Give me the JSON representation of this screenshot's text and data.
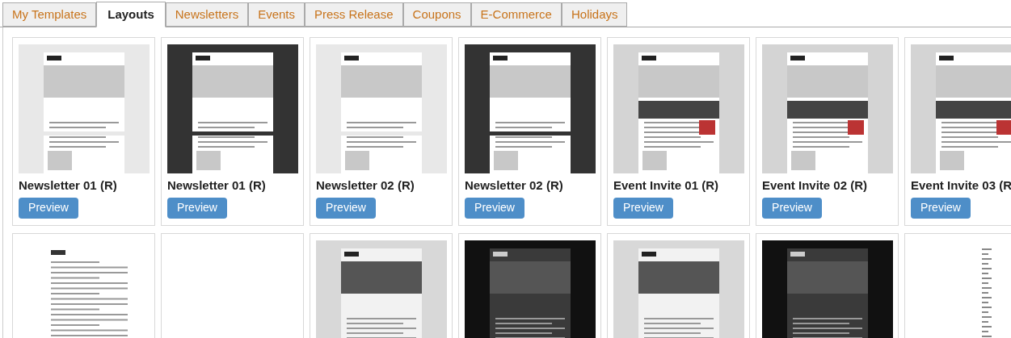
{
  "tabs": [
    {
      "label": "My Templates",
      "selected": false
    },
    {
      "label": "Layouts",
      "selected": true
    },
    {
      "label": "Newsletters",
      "selected": false
    },
    {
      "label": "Events",
      "selected": false
    },
    {
      "label": "Press Release",
      "selected": false
    },
    {
      "label": "Coupons",
      "selected": false
    },
    {
      "label": "E-Commerce",
      "selected": false
    },
    {
      "label": "Holidays",
      "selected": false
    }
  ],
  "template_rows": [
    [
      {
        "kind": "newsletter-light",
        "title": "Newsletter 01 (R)",
        "button": "Preview"
      },
      {
        "kind": "newsletter-dark",
        "title": "Newsletter 01 (R)",
        "button": "Preview"
      },
      {
        "kind": "newsletter-light",
        "title": "Newsletter 02 (R)",
        "button": "Preview"
      },
      {
        "kind": "newsletter-dark",
        "title": "Newsletter 02 (R)",
        "button": "Preview"
      },
      {
        "kind": "event",
        "title": "Event Invite 01 (R)",
        "button": "Preview"
      },
      {
        "kind": "event",
        "title": "Event Invite 02 (R)",
        "button": "Preview"
      },
      {
        "kind": "event",
        "title": "Event Invite 03 (R",
        "button": "Preview"
      }
    ],
    [
      {
        "kind": "letter"
      },
      {
        "kind": "blank"
      },
      {
        "kind": "photo-light"
      },
      {
        "kind": "photo-dark"
      },
      {
        "kind": "photo-light"
      },
      {
        "kind": "photo-dark"
      },
      {
        "kind": "list"
      }
    ]
  ]
}
